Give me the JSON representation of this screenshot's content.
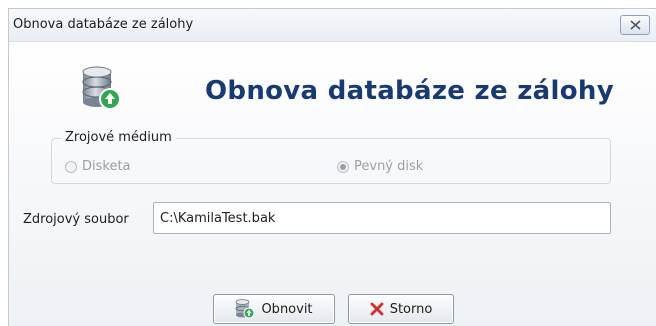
{
  "window": {
    "title": "Obnova databáze ze zálohy"
  },
  "header": {
    "title": "Obnova databáze ze zálohy"
  },
  "source_medium": {
    "label": "Zrojové médium",
    "options": [
      {
        "label": "Disketa",
        "selected": false,
        "enabled": false
      },
      {
        "label": "Pevný disk",
        "selected": true,
        "enabled": false
      }
    ]
  },
  "source_file": {
    "label": "Zdrojový soubor",
    "value": "C:\\KamilaTest.bak"
  },
  "buttons": {
    "restore": "Obnovit",
    "cancel": "Storno"
  },
  "colors": {
    "title_text": "#173a75",
    "restore_arrow": "#2fa84f",
    "cancel_x": "#d62b2b"
  },
  "icons": {
    "header": "database-restore-icon",
    "restore": "database-restore-icon",
    "cancel": "x-icon",
    "close": "close-icon"
  }
}
